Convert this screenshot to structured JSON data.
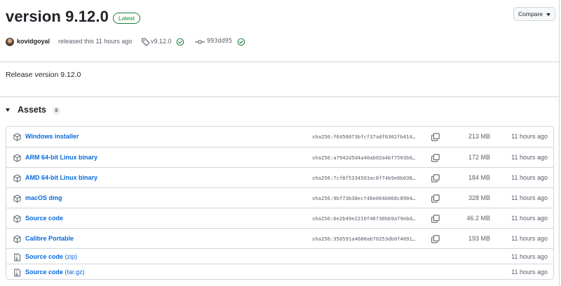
{
  "header": {
    "title": "version 9.12.0",
    "latest_badge": "Latest",
    "compare_label": "Compare"
  },
  "meta": {
    "author": "kovidgoyal",
    "released_text": "released this 11 hours ago",
    "tag": "v9.12.0",
    "commit": "993dd95"
  },
  "body": {
    "text": "Release version 9.12.0"
  },
  "assets": {
    "title": "Assets",
    "count": "8",
    "items": [
      {
        "name": "Windows installer",
        "sha": "sha256:f6456073bfcf37adf6302fb414…",
        "size": "213 MB",
        "time": "11 hours ago",
        "icon": "package-icon"
      },
      {
        "name": "ARM 64-bit Linux binary",
        "sha": "sha256:a7942d5d4a40ab02a4bf7503b0…",
        "size": "172 MB",
        "time": "11 hours ago",
        "icon": "package-icon"
      },
      {
        "name": "AMD 64-bit Linux binary",
        "sha": "sha256:7cf8f5334503ac8f74b9e0b038…",
        "size": "184 MB",
        "time": "11 hours ago",
        "icon": "package-icon"
      },
      {
        "name": "macOS dmg",
        "sha": "sha256:9bf73b38ecf46e064b068c8904…",
        "size": "328 MB",
        "time": "11 hours ago",
        "icon": "package-icon"
      },
      {
        "name": "Source code",
        "sha": "sha256:6e2b49e2210f46730bb9a79ebd…",
        "size": "46.2 MB",
        "time": "11 hours ago",
        "icon": "package-icon"
      },
      {
        "name": "Calibre Portable",
        "sha": "sha256:350591a4680ab70253db0f4091…",
        "size": "193 MB",
        "time": "11 hours ago",
        "icon": "package-icon"
      },
      {
        "name": "Source code",
        "suffix": "(zip)",
        "sha": "",
        "size": "",
        "time": "11 hours ago",
        "icon": "file-zip-icon"
      },
      {
        "name": "Source code",
        "suffix": "(tar.gz)",
        "sha": "",
        "size": "",
        "time": "11 hours ago",
        "icon": "file-zip-icon"
      }
    ]
  }
}
